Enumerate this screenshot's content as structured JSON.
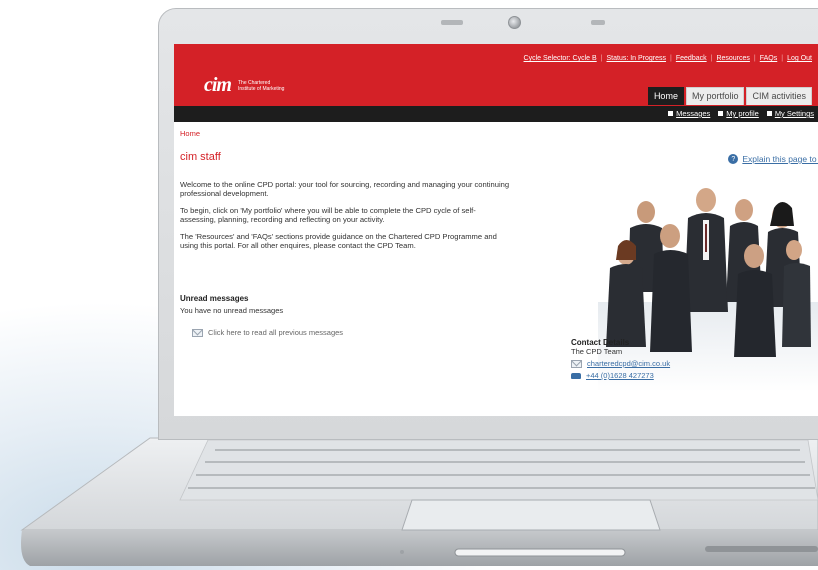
{
  "top_links": [
    {
      "label": "Cycle Selector: Cycle B"
    },
    {
      "label": "Status: In Progress"
    },
    {
      "label": "Feedback"
    },
    {
      "label": "Resources"
    },
    {
      "label": "FAQs"
    },
    {
      "label": "Log Out"
    }
  ],
  "logo": {
    "mark": "cim",
    "line1": "The Chartered",
    "line2": "Institute of Marketing"
  },
  "tabs": [
    {
      "label": "Home",
      "active": true
    },
    {
      "label": "My portfolio",
      "active": false
    },
    {
      "label": "CIM activities",
      "active": false
    }
  ],
  "sub_links": [
    {
      "label": "Messages"
    },
    {
      "label": "My profile"
    },
    {
      "label": "My Settings"
    }
  ],
  "breadcrumb": "Home",
  "page_title": "cim staff",
  "explain_link": "Explain this page to m",
  "paragraphs": [
    "Welcome to the online CPD portal: your tool for sourcing, recording and managing your continuing professional development.",
    "To begin, click on 'My portfolio' where you will be able to complete the CPD cycle of self-assessing, planning, recording and reflecting on your activity.",
    "The 'Resources' and 'FAQs' sections provide guidance on the Chartered CPD Programme and using this portal. For all other enquires, please contact the CPD Team."
  ],
  "unread": {
    "heading": "Unread messages",
    "text": "You have no unread messages",
    "read_all": "Click here to read all previous messages"
  },
  "contact": {
    "heading": "Contact Details",
    "team": "The CPD Team",
    "email": "charteredcpd@cim.co.uk",
    "phone": "+44 (0)1628 427273"
  },
  "colors": {
    "brand_red": "#d42127",
    "nav_black": "#1d1d1d",
    "link_blue": "#3a6ea5"
  }
}
